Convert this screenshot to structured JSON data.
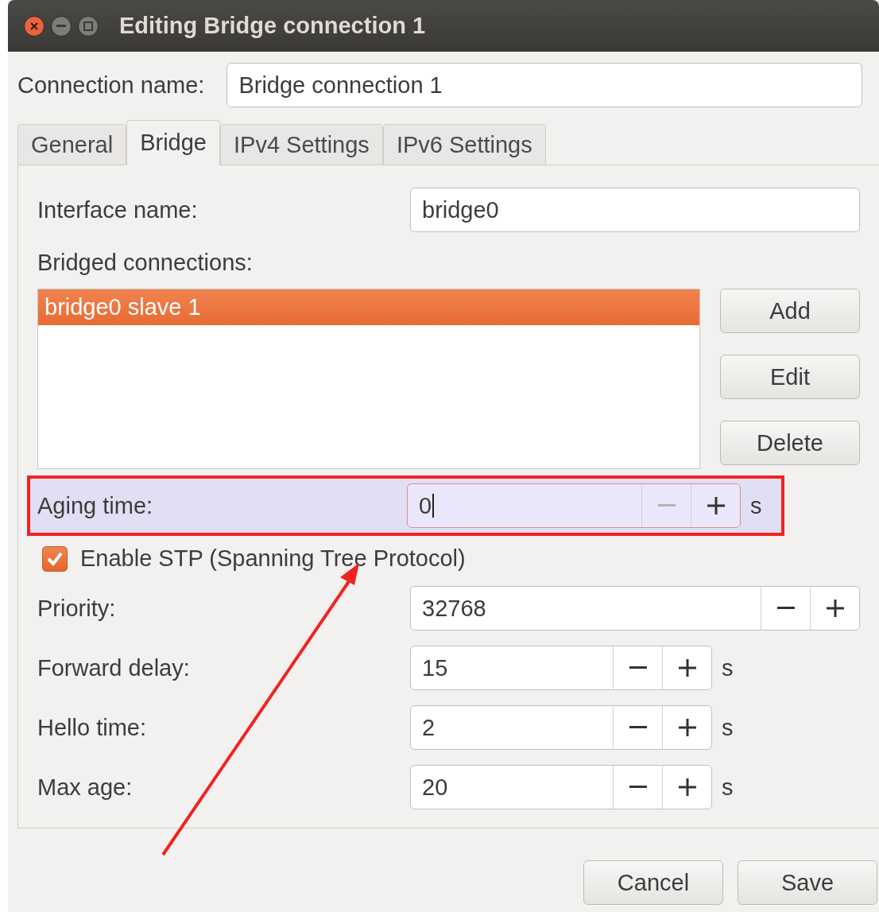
{
  "window": {
    "title": "Editing Bridge connection 1"
  },
  "connection_name": {
    "label": "Connection name:",
    "value": "Bridge connection 1"
  },
  "tabs": [
    {
      "label": "General",
      "selected": false
    },
    {
      "label": "Bridge",
      "selected": true
    },
    {
      "label": "IPv4 Settings",
      "selected": false
    },
    {
      "label": "IPv6 Settings",
      "selected": false
    }
  ],
  "interface_name": {
    "label": "Interface name:",
    "value": "bridge0"
  },
  "bridged_connections": {
    "label": "Bridged connections:",
    "items": [
      {
        "label": "bridge0 slave 1",
        "selected": true
      }
    ],
    "buttons": [
      "Add",
      "Edit",
      "Delete"
    ]
  },
  "aging_time": {
    "label": "Aging time:",
    "value": "0",
    "unit": "s",
    "highlighted": true,
    "focused": true,
    "decrement_disabled": true
  },
  "stp": {
    "label": "Enable STP (Spanning Tree Protocol)",
    "checked": true
  },
  "stp_fields": [
    {
      "label": "Priority:",
      "value": "32768",
      "kind": "wide"
    },
    {
      "label": "Forward delay:",
      "value": "15",
      "unit": "s",
      "kind": "unit"
    },
    {
      "label": "Hello time:",
      "value": "2",
      "unit": "s",
      "kind": "unit"
    },
    {
      "label": "Max age:",
      "value": "20",
      "unit": "s",
      "kind": "unit"
    }
  ],
  "footer_buttons": [
    "Cancel",
    "Save"
  ]
}
